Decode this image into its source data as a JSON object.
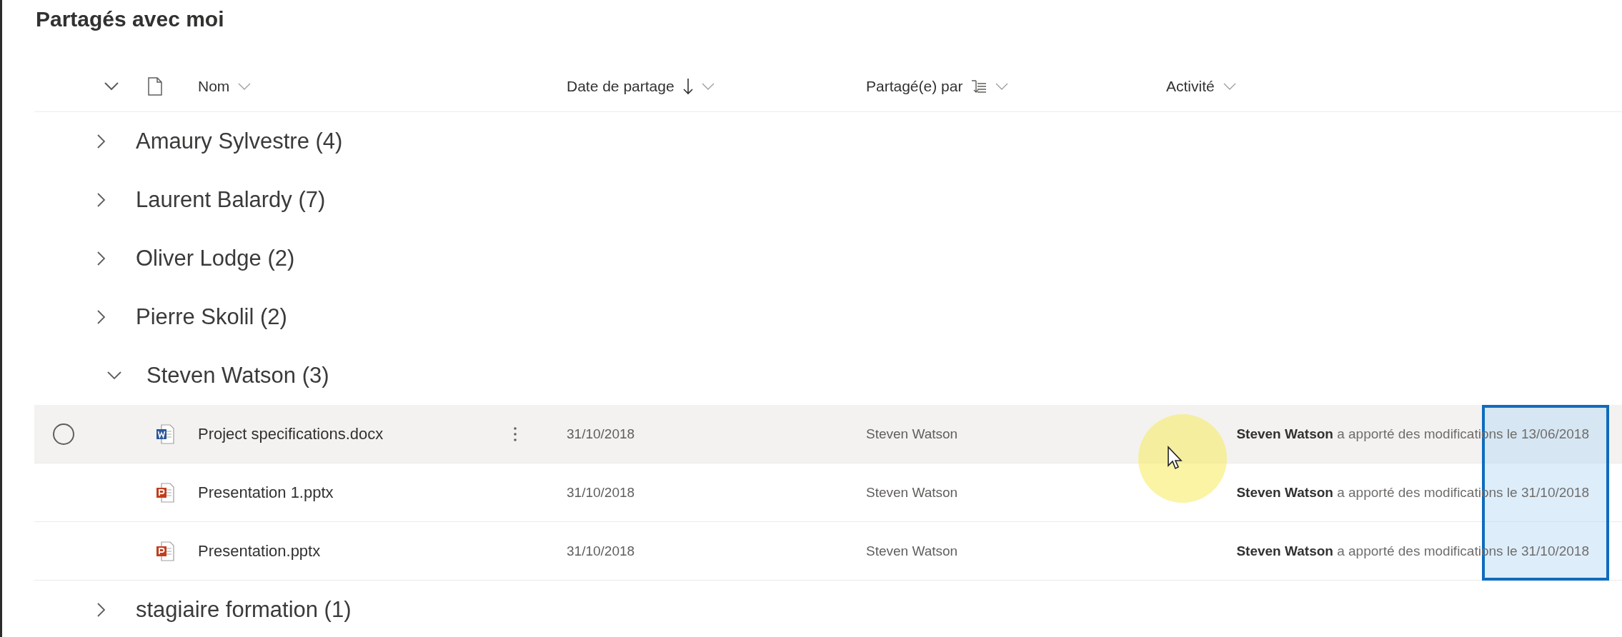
{
  "title": "Partagés avec moi",
  "columns": [
    {
      "label": "Nom",
      "sorted_descending": false,
      "grouped": false
    },
    {
      "label": "Date de partage",
      "sorted_descending": true,
      "grouped": false
    },
    {
      "label": "Partagé(e) par",
      "sorted_descending": false,
      "grouped": true
    },
    {
      "label": "Activité",
      "sorted_descending": false,
      "grouped": false
    }
  ],
  "groups": [
    {
      "label": "Amaury Sylvestre (4)",
      "expanded": false
    },
    {
      "label": "Laurent Balardy (7)",
      "expanded": false
    },
    {
      "label": "Oliver Lodge (2)",
      "expanded": false
    },
    {
      "label": "Pierre Skolil (2)",
      "expanded": false
    },
    {
      "label": "Steven Watson (3)",
      "expanded": true,
      "files": [
        {
          "kind": "word",
          "name": "Project specifications.docx",
          "hovered": true,
          "date": "31/10/2018",
          "shared_by": "Steven Watson",
          "activity": "**Steven Watson** a apporté des modifications le 13/06/2018"
        },
        {
          "kind": "powerpoint",
          "name": "Presentation 1.pptx",
          "hovered": false,
          "date": "31/10/2018",
          "shared_by": "Steven Watson",
          "activity": "**Steven Watson** a apporté des modifications le 31/10/2018"
        },
        {
          "kind": "powerpoint",
          "name": "Presentation.pptx",
          "hovered": false,
          "date": "31/10/2018",
          "shared_by": "Steven Watson",
          "activity": "**Steven Watson** a apporté des modifications le 31/10/2018"
        }
      ]
    },
    {
      "label": "stagiaire formation (1)",
      "expanded": false
    }
  ]
}
